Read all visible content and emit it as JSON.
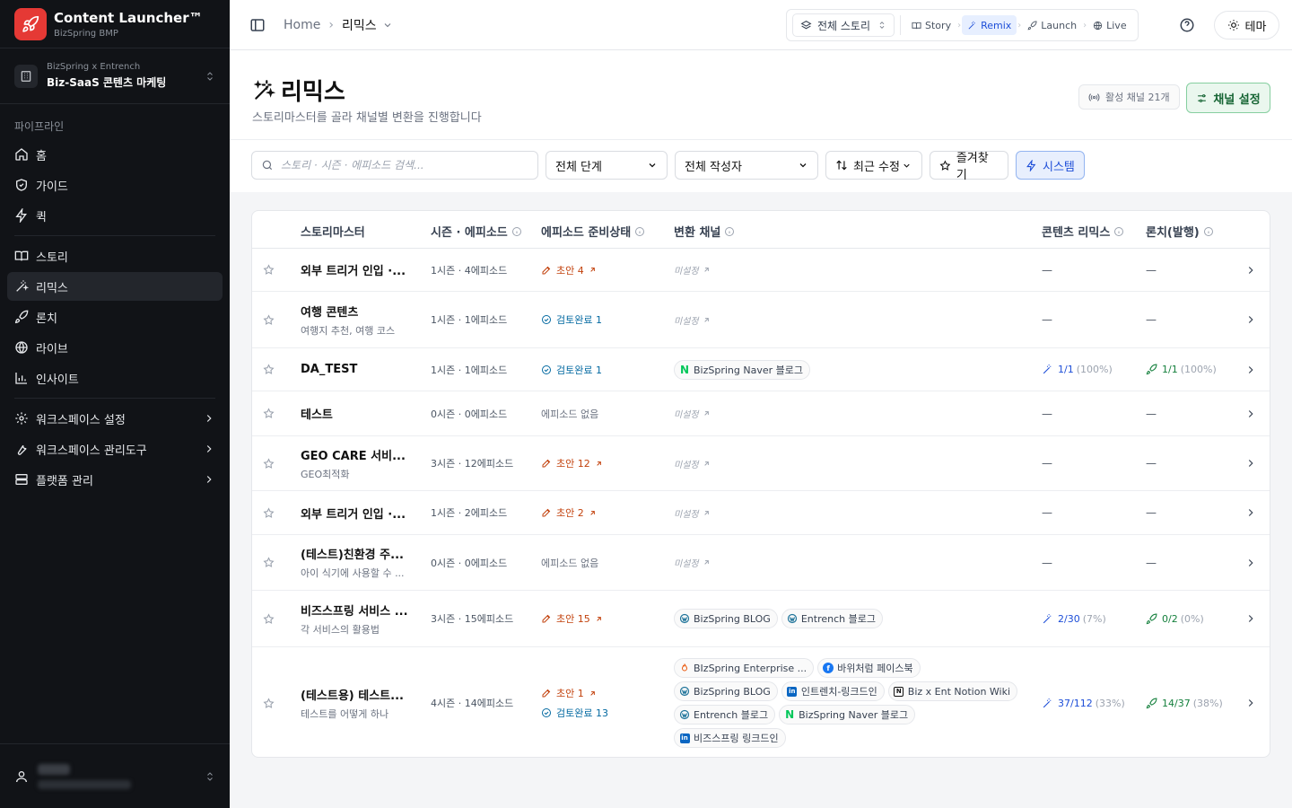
{
  "sidebar": {
    "brand_title": "Content Launcher™",
    "brand_sub": "BizSpring BMP",
    "workspace_org": "BizSpring x Entrench",
    "workspace_name": "Biz-SaaS 콘텐츠 마케팅",
    "section_label": "파이프라인",
    "items": [
      {
        "label": "홈",
        "icon": "home-icon"
      },
      {
        "label": "가이드",
        "icon": "shield-icon"
      },
      {
        "label": "퀵",
        "icon": "zap-icon"
      },
      {
        "label": "스토리",
        "icon": "book-icon"
      },
      {
        "label": "리믹스",
        "icon": "wand-icon"
      },
      {
        "label": "론치",
        "icon": "rocket-icon"
      },
      {
        "label": "라이브",
        "icon": "globe-icon"
      },
      {
        "label": "인사이트",
        "icon": "chart-icon"
      }
    ],
    "settings": [
      {
        "label": "워크스페이스 설정",
        "icon": "gear-icon"
      },
      {
        "label": "워크스페이스 관리도구",
        "icon": "wrench-icon"
      },
      {
        "label": "플랫폼 관리",
        "icon": "server-icon"
      }
    ]
  },
  "header": {
    "breadcrumb_home": "Home",
    "breadcrumb_current": "리믹스",
    "story_filter": "전체 스토리",
    "pipeline_steps": [
      "Story",
      "Remix",
      "Launch",
      "Live"
    ],
    "theme_label": "테마"
  },
  "page": {
    "title": "리믹스",
    "subtitle": "스토리마스터를 골라 채널별 변환을 진행합니다",
    "active_channels": "활성 채널 21개",
    "channel_settings": "채널 설정"
  },
  "filters": {
    "search_placeholder": "스토리 · 시즌 · 에피소드 검색...",
    "stage": "전체 단계",
    "author": "전체 작성자",
    "sort": "최근 수정",
    "favorites": "즐겨찾기",
    "system": "시스템"
  },
  "table": {
    "headers": {
      "story": "스토리마스터",
      "season": "시즌 · 에피소드",
      "ready": "에피소드 준비상태",
      "channel": "변환 채널",
      "remix": "콘텐츠 리믹스",
      "launch": "론치(발행)"
    },
    "unset_label": "미설정",
    "dash": "—",
    "rows": [
      {
        "name": "외부 트리거 인입 ·...",
        "sub": "",
        "season": "1시즌 · 4에피소드",
        "ready": [
          {
            "type": "draft",
            "text": "초안 4",
            "link": true
          }
        ],
        "channels": [],
        "remix": null,
        "launch": null
      },
      {
        "name": "여행 콘텐츠",
        "sub": "여행지 추천, 여행 코스",
        "season": "1시즌 · 1에피소드",
        "ready": [
          {
            "type": "done",
            "text": "검토완료 1",
            "link": false
          }
        ],
        "channels": [],
        "remix": null,
        "launch": null
      },
      {
        "name": "DA_TEST",
        "sub": "",
        "season": "1시즌 · 1에피소드",
        "ready": [
          {
            "type": "done",
            "text": "검토완료 1",
            "link": false
          }
        ],
        "channels": [
          {
            "icon": "naver",
            "label": "BizSpring Naver 블로그"
          }
        ],
        "remix": {
          "num": "1/1",
          "pct": "(100%)"
        },
        "launch": {
          "num": "1/1",
          "pct": "(100%)"
        }
      },
      {
        "name": "테스트",
        "sub": "",
        "season": "0시즌 · 0에피소드",
        "ready": [
          {
            "type": "none",
            "text": "에피소드 없음",
            "link": false
          }
        ],
        "channels": [],
        "remix": null,
        "launch": null
      },
      {
        "name": "GEO CARE 서비...",
        "sub": "GEO최적화",
        "season": "3시즌 · 12에피소드",
        "ready": [
          {
            "type": "draft",
            "text": "초안 12",
            "link": true
          }
        ],
        "channels": [],
        "remix": null,
        "launch": null
      },
      {
        "name": "외부 트리거 인입 ·...",
        "sub": "",
        "season": "1시즌 · 2에피소드",
        "ready": [
          {
            "type": "draft",
            "text": "초안 2",
            "link": true
          }
        ],
        "channels": [],
        "remix": null,
        "launch": null
      },
      {
        "name": "(테스트)친환경 주...",
        "sub": "아이 식기에 사용할 수 ...",
        "season": "0시즌 · 0에피소드",
        "ready": [
          {
            "type": "none",
            "text": "에피소드 없음",
            "link": false
          }
        ],
        "channels": [],
        "remix": null,
        "launch": null
      },
      {
        "name": "비즈스프링 서비스 ...",
        "sub": "각 서비스의 활용법",
        "season": "3시즌 · 15에피소드",
        "ready": [
          {
            "type": "draft",
            "text": "초안 15",
            "link": true
          }
        ],
        "channels": [
          {
            "icon": "wp",
            "label": "BizSpring BLOG"
          },
          {
            "icon": "wp",
            "label": "Entrench 블로그"
          }
        ],
        "remix": {
          "num": "2/30",
          "pct": "(7%)"
        },
        "launch": {
          "num": "0/2",
          "pct": "(0%)"
        }
      },
      {
        "name": "(테스트용) 테스트...",
        "sub": "테스트를 어떻게 하나",
        "season": "4시즌 · 14에피소드",
        "ready": [
          {
            "type": "draft",
            "text": "초안 1",
            "link": true
          },
          {
            "type": "done",
            "text": "검토완료 13",
            "link": false
          }
        ],
        "channels": [
          {
            "icon": "flame",
            "label": "BIzSpring Enterprise ..."
          },
          {
            "icon": "fb",
            "label": "바위처럼 페이스북"
          },
          {
            "icon": "wp",
            "label": "BizSpring BLOG"
          },
          {
            "icon": "in",
            "label": "인트렌치-링크드인"
          },
          {
            "icon": "notion",
            "label": "Biz x Ent Notion Wiki"
          },
          {
            "icon": "wp",
            "label": "Entrench 블로그"
          },
          {
            "icon": "naver",
            "label": "BizSpring Naver 블로그"
          },
          {
            "icon": "in",
            "label": "비즈스프링 링크드인"
          }
        ],
        "remix": {
          "num": "37/112",
          "pct": "(33%)"
        },
        "launch": {
          "num": "14/37",
          "pct": "(38%)"
        }
      }
    ]
  },
  "colors": {
    "accent": "#1d4ed8",
    "brand": "#e53935",
    "launch": "#15803d",
    "draft": "#c2410c",
    "done": "#0369a1"
  }
}
